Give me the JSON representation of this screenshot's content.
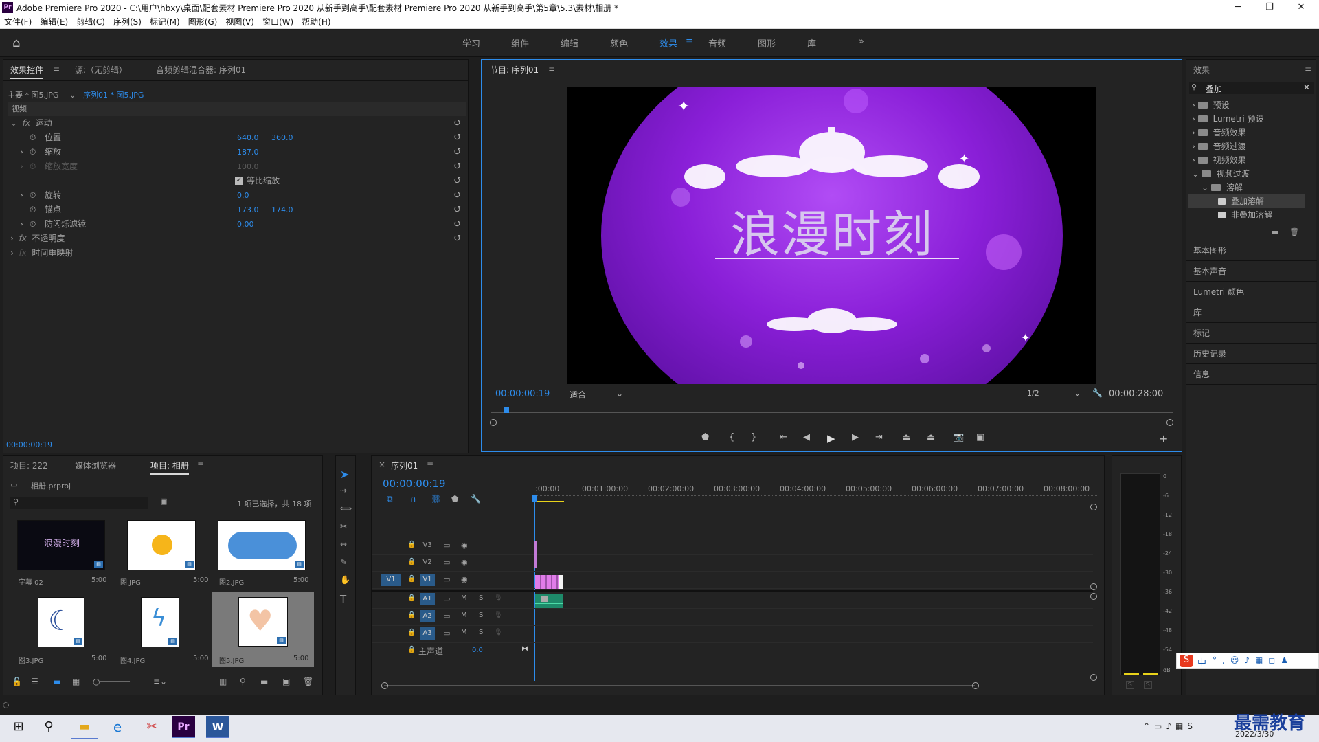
{
  "window": {
    "title": "Adobe Premiere Pro 2020 - C:\\用户\\hbxy\\桌面\\配套素材 Premiere Pro 2020 从新手到高手\\配套素材 Premiere Pro 2020 从新手到高手\\第5章\\5.3\\素材\\相册 *",
    "logo": "Pr"
  },
  "menu": [
    "文件(F)",
    "编辑(E)",
    "剪辑(C)",
    "序列(S)",
    "标记(M)",
    "图形(G)",
    "视图(V)",
    "窗口(W)",
    "帮助(H)"
  ],
  "workspaces": [
    "学习",
    "组件",
    "编辑",
    "颜色",
    "效果",
    "音频",
    "图形",
    "库"
  ],
  "effect_controls": {
    "tabs": [
      "效果控件",
      "源:（无剪辑）",
      "音频剪辑混合器: 序列01"
    ],
    "master": "主要 * 图5.JPG",
    "clip": "序列01 * 图5.JPG",
    "section": "视频",
    "motion": "运动",
    "position_label": "位置",
    "position_x": "640.0",
    "position_y": "360.0",
    "scale_label": "缩放",
    "scale_value": "187.0",
    "scale_width_label": "缩放宽度",
    "scale_width_value": "100.0",
    "uniform_label": "等比缩放",
    "rotation_label": "旋转",
    "rotation_value": "0.0",
    "anchor_label": "锚点",
    "anchor_x": "173.0",
    "anchor_y": "174.0",
    "flicker_label": "防闪烁滤镜",
    "flicker_value": "0.00",
    "opacity": "不透明度",
    "time_remap": "时间重映射",
    "timecode": "00:00:00:19"
  },
  "program": {
    "title": "节目: 序列01",
    "title_text": "浪漫时刻",
    "timecode": "00:00:00:19",
    "fit": "适合",
    "resolution": "1/2",
    "duration": "00:00:28:00"
  },
  "project": {
    "tabs": [
      "项目: 222",
      "媒体浏览器",
      "项目: 相册"
    ],
    "file": "相册.prproj",
    "selection": "1 项已选择，共 18 项",
    "items": [
      {
        "name": "字幕 02",
        "duration": "5:00"
      },
      {
        "name": "图.JPG",
        "duration": "5:00"
      },
      {
        "name": "图2.JPG",
        "duration": "5:00"
      },
      {
        "name": "图3.JPG",
        "duration": "5:00"
      },
      {
        "name": "图4.JPG",
        "duration": "5:00"
      },
      {
        "name": "图5.JPG",
        "duration": "5:00"
      }
    ],
    "thumb_text": "浪漫时刻"
  },
  "timeline": {
    "tab": "序列01",
    "timecode": "00:00:00:19",
    "ruler": [
      ":00:00",
      "00:01:00:00",
      "00:02:00:00",
      "00:03:00:00",
      "00:04:00:00",
      "00:05:00:00",
      "00:06:00:00",
      "00:07:00:00",
      "00:08:00:00"
    ],
    "tracks": [
      "V3",
      "V2",
      "V1",
      "A1",
      "A2",
      "A3"
    ],
    "source_v1": "V1",
    "master": "主声道",
    "master_value": "0.0",
    "m": "M",
    "s": "S"
  },
  "meter": {
    "scale": [
      "0",
      "-6",
      "-12",
      "-18",
      "-24",
      "-30",
      "-36",
      "-42",
      "-48",
      "-54",
      "dB"
    ],
    "s": "S"
  },
  "effects": {
    "title": "效果",
    "search": "叠加",
    "tree": [
      "预设",
      "Lumetri 预设",
      "音频效果",
      "音频过渡",
      "视频效果",
      "视频过渡",
      "溶解",
      "叠加溶解",
      "非叠加溶解"
    ],
    "panels": [
      "基本图形",
      "基本声音",
      "Lumetri 颜色",
      "库",
      "标记",
      "历史记录",
      "信息"
    ]
  },
  "taskbar": {
    "date": "2022/3/30",
    "watermark": "最需教育",
    "ime": "中"
  }
}
